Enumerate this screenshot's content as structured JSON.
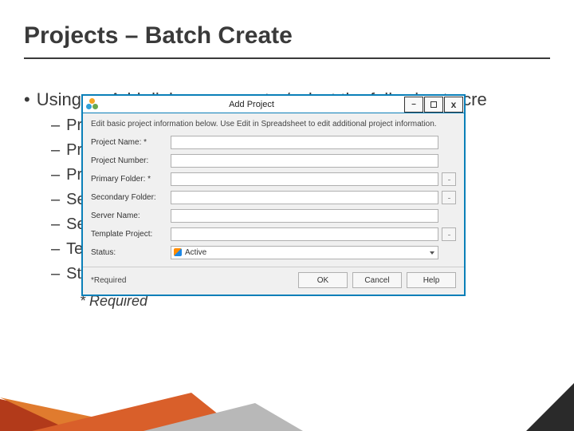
{
  "title": "Projects – Batch Create",
  "bullet": "Using an Add dialog users enter/select the following to cre",
  "subs": [
    "Pro",
    "Pro",
    "Pri",
    "Se.",
    "Se",
    "Tei",
    "Status"
  ],
  "required_note": "* Required",
  "dialog": {
    "title": "Add Project",
    "instruction": "Edit basic project information below. Use Edit in Spreadsheet to edit additional project information.",
    "labels": {
      "project_name": "Project Name: *",
      "project_number": "Project Number:",
      "primary_folder": "Primary Folder: *",
      "secondary_folder": "Secondary Folder:",
      "server_name": "Server Name:",
      "template_project": "Template Project:",
      "status": "Status:"
    },
    "status_value": "Active",
    "required_label": "*Required",
    "buttons": {
      "ok": "OK",
      "cancel": "Cancel",
      "help": "Help"
    },
    "win": {
      "min": "–",
      "close": "x"
    }
  }
}
